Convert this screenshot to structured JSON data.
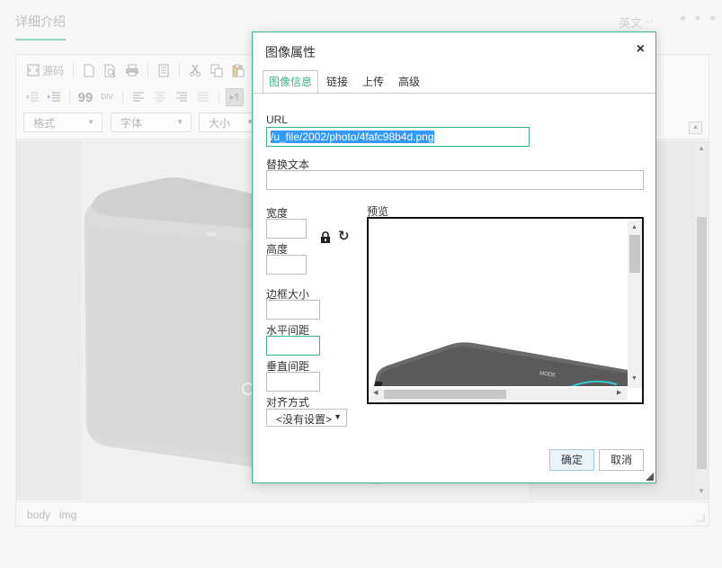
{
  "page": {
    "title": "详细介绍",
    "language": "英文",
    "more": "• • •"
  },
  "toolbar": {
    "source_label": "源码",
    "format_label": "格式",
    "font_label": "字体",
    "size_label": "大小"
  },
  "status_bar": {
    "path": [
      "body",
      "img"
    ]
  },
  "dialog": {
    "title": "图像属性",
    "close": "×",
    "tabs": [
      "图像信息",
      "链接",
      "上传",
      "高级"
    ],
    "active_tab": "图像信息",
    "url_label": "URL",
    "url_value": "/u_file/2002/photo/4fafc98b4d.png",
    "alt_label": "替换文本",
    "alt_value": "",
    "width_label": "宽度",
    "width_value": "",
    "height_label": "高度",
    "height_value": "",
    "border_label": "边框大小",
    "border_value": "",
    "hspace_label": "水平间距",
    "hspace_value": "",
    "vspace_label": "垂直间距",
    "vspace_value": "",
    "align_label": "对齐方式",
    "align_value": "<没有设置>",
    "preview_label": "预览",
    "preview_logo": "MODE",
    "ok_label": "确定",
    "cancel_label": "取消"
  },
  "colors": {
    "accent": "#3fb08a",
    "selection": "#3399ff"
  }
}
